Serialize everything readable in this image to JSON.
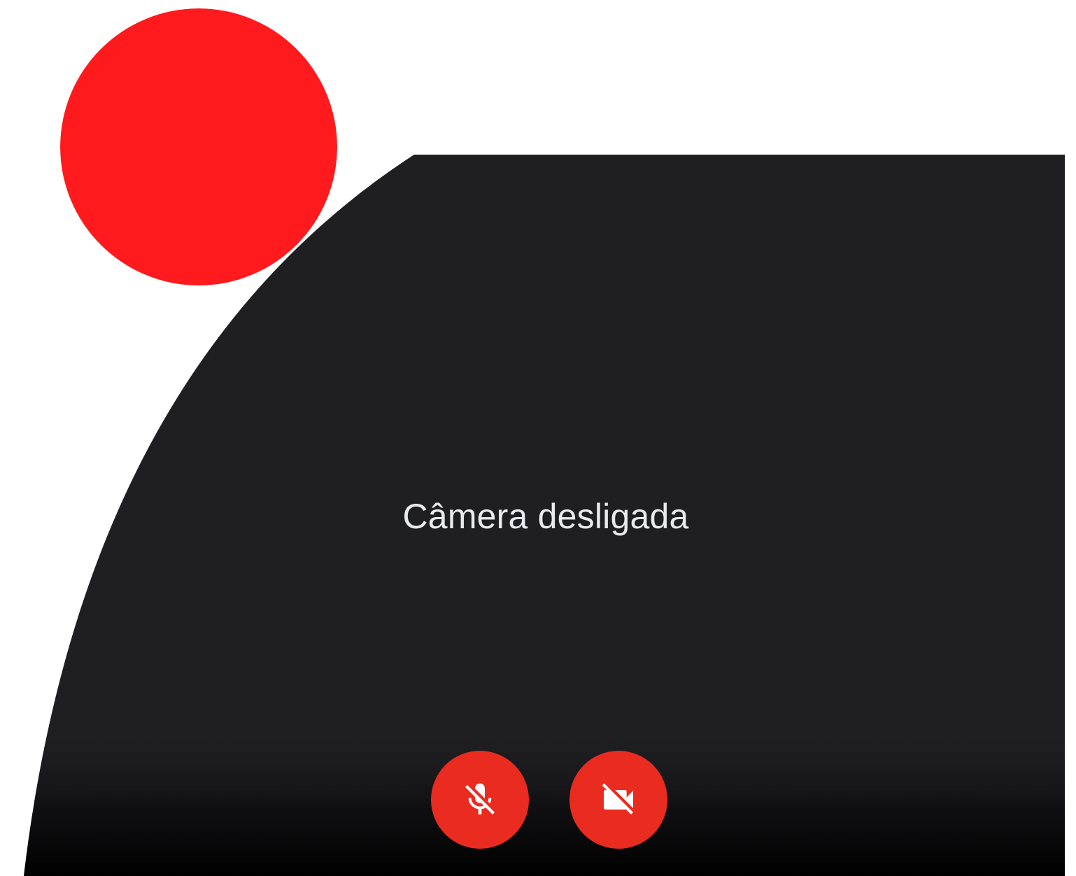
{
  "video_tile": {
    "status_text": "Câmera desligada",
    "background_color": "#1f1f22"
  },
  "controls": {
    "mic_button": {
      "icon": "mic-off-icon",
      "state": "off",
      "color": "#ea2b20"
    },
    "camera_button": {
      "icon": "videocam-off-icon",
      "state": "off",
      "color": "#ea2b20"
    }
  },
  "overlay": {
    "record_indicator_icon": "record-dot-icon",
    "record_indicator_color": "#ff1a1e"
  }
}
